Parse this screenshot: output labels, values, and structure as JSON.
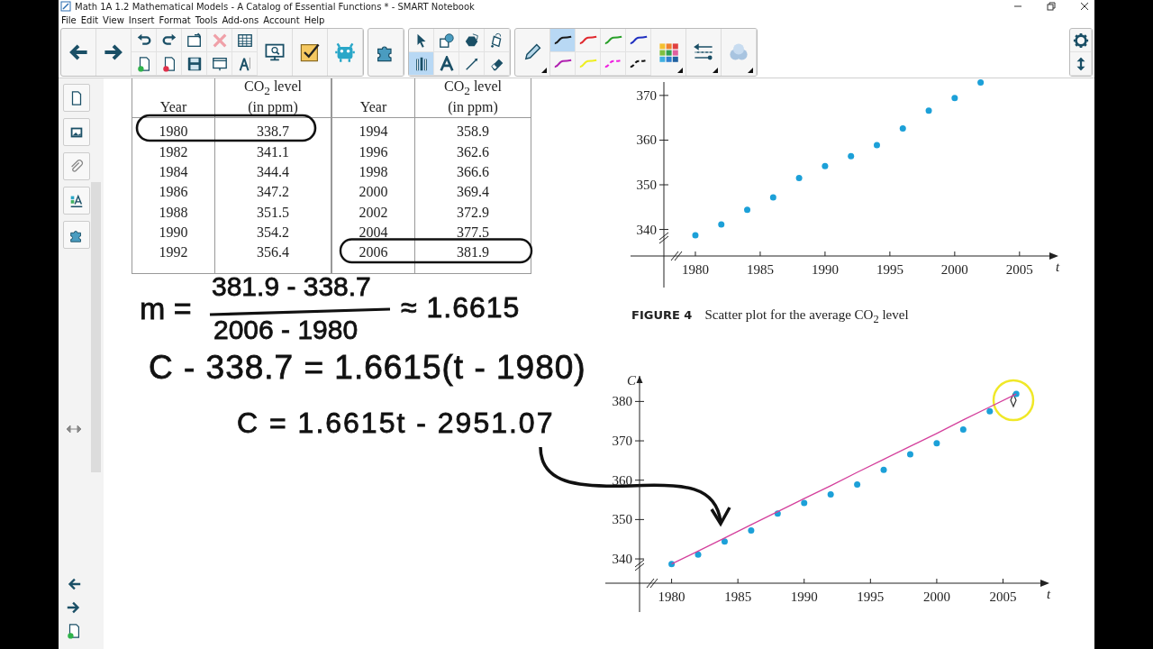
{
  "window": {
    "title": "Math 1A 1.2 Mathematical Models - A Catalog of Essential Functions * - SMART Notebook"
  },
  "menu": [
    "File",
    "Edit",
    "View",
    "Insert",
    "Format",
    "Tools",
    "Add-ons",
    "Account",
    "Help"
  ],
  "tools": [
    {
      "kind": "select",
      "selected": false
    },
    {
      "kind": "shapes",
      "selected": false
    },
    {
      "kind": "polygons",
      "selected": false
    },
    {
      "kind": "fill",
      "selected": false
    },
    {
      "kind": "pens",
      "selected": true
    },
    {
      "kind": "text",
      "selected": false
    },
    {
      "kind": "lines",
      "selected": false
    },
    {
      "kind": "eraser",
      "selected": false
    }
  ],
  "pen_styles": [
    {
      "kind": "solid",
      "color": "#1a1a1a",
      "selected": true
    },
    {
      "kind": "solid",
      "color": "#e0282e",
      "selected": false
    },
    {
      "kind": "solid",
      "color": "#2aa02a",
      "selected": false
    },
    {
      "kind": "solid",
      "color": "#2030c0",
      "selected": false
    },
    {
      "kind": "solid",
      "color": "#b020b0",
      "selected": false
    },
    {
      "kind": "solid",
      "color": "#eeee20",
      "selected": false
    },
    {
      "kind": "dashed",
      "color": "#f020e0",
      "selected": false
    },
    {
      "kind": "dashed",
      "color": "#111111",
      "selected": false
    }
  ],
  "table": {
    "halves": [
      {
        "columns": [
          {
            "title": "Year"
          },
          {
            "title": "CO$_{2}$ level",
            "unit": "(in ppm)"
          }
        ],
        "rows": [
          [
            "1980",
            "338.7"
          ],
          [
            "1982",
            "341.1"
          ],
          [
            "1984",
            "344.4"
          ],
          [
            "1986",
            "347.2"
          ],
          [
            "1988",
            "351.5"
          ],
          [
            "1990",
            "354.2"
          ],
          [
            "1992",
            "356.4"
          ]
        ]
      },
      {
        "columns": [
          {
            "title": "Year"
          },
          {
            "title": "CO$_{2}$ level",
            "unit": "(in ppm)"
          }
        ],
        "rows": [
          [
            "1994",
            "358.9"
          ],
          [
            "1996",
            "362.6"
          ],
          [
            "1998",
            "366.6"
          ],
          [
            "2000",
            "369.4"
          ],
          [
            "2002",
            "372.9"
          ],
          [
            "2004",
            "377.5"
          ],
          [
            "2006",
            "381.9"
          ]
        ]
      }
    ]
  },
  "handwriting": {
    "slope_label": "m =",
    "numerator": "381.9 - 338.7",
    "denominator": "2006 - 1980",
    "approx": "≈ 1.6615",
    "point_slope": "C - 338.7 = 1.6615(t - 1980)",
    "line_equation": "C = 1.6615t - 2951.07"
  },
  "figure_4": {
    "chart_data": {
      "type": "scatter",
      "xlabel": "t",
      "x": [
        1980,
        1982,
        1984,
        1986,
        1988,
        1990,
        1992,
        1994,
        1996,
        1998,
        2000,
        2002
      ],
      "series": [
        {
          "color": "#1ca0d8",
          "values": [
            338.7,
            341.1,
            344.4,
            347.2,
            351.5,
            354.2,
            356.4,
            358.9,
            362.6,
            366.6,
            369.4,
            372.9
          ]
        }
      ],
      "xlim": [
        1975,
        2008
      ],
      "ylim": [
        327,
        373
      ],
      "xticks": [
        1980,
        1985,
        1990,
        1995,
        2000,
        2005
      ],
      "yticks": [
        340,
        350,
        360,
        370
      ]
    },
    "label": "FIGURE 4",
    "caption": "Scatter plot for the average CO$_{2}$ level"
  },
  "figure_5": {
    "chart_data": {
      "type": "scatter",
      "xlabel": "t",
      "ylabel": "C",
      "x": [
        1980,
        1982,
        1984,
        1986,
        1988,
        1990,
        1992,
        1994,
        1996,
        1998,
        2000,
        2002,
        2004,
        2006
      ],
      "series": [
        {
          "color": "#1ca0d8",
          "values": [
            338.7,
            341.1,
            344.4,
            347.2,
            351.5,
            354.2,
            356.4,
            358.9,
            362.6,
            366.6,
            369.4,
            372.9,
            377.5,
            381.9
          ]
        },
        {
          "type": "line",
          "color": "#d4409c",
          "values": [
            338.7,
            342.0,
            345.3,
            348.7,
            352.0,
            355.3,
            358.6,
            362.0,
            365.3,
            368.6,
            371.9,
            375.3,
            378.6,
            381.9
          ]
        }
      ],
      "xlim": [
        1975,
        2008.5
      ],
      "ylim": [
        326.5,
        386.5
      ],
      "xticks": [
        1980,
        1985,
        1990,
        1995,
        2000,
        2005
      ],
      "yticks": [
        340,
        350,
        360,
        370,
        380
      ]
    }
  }
}
